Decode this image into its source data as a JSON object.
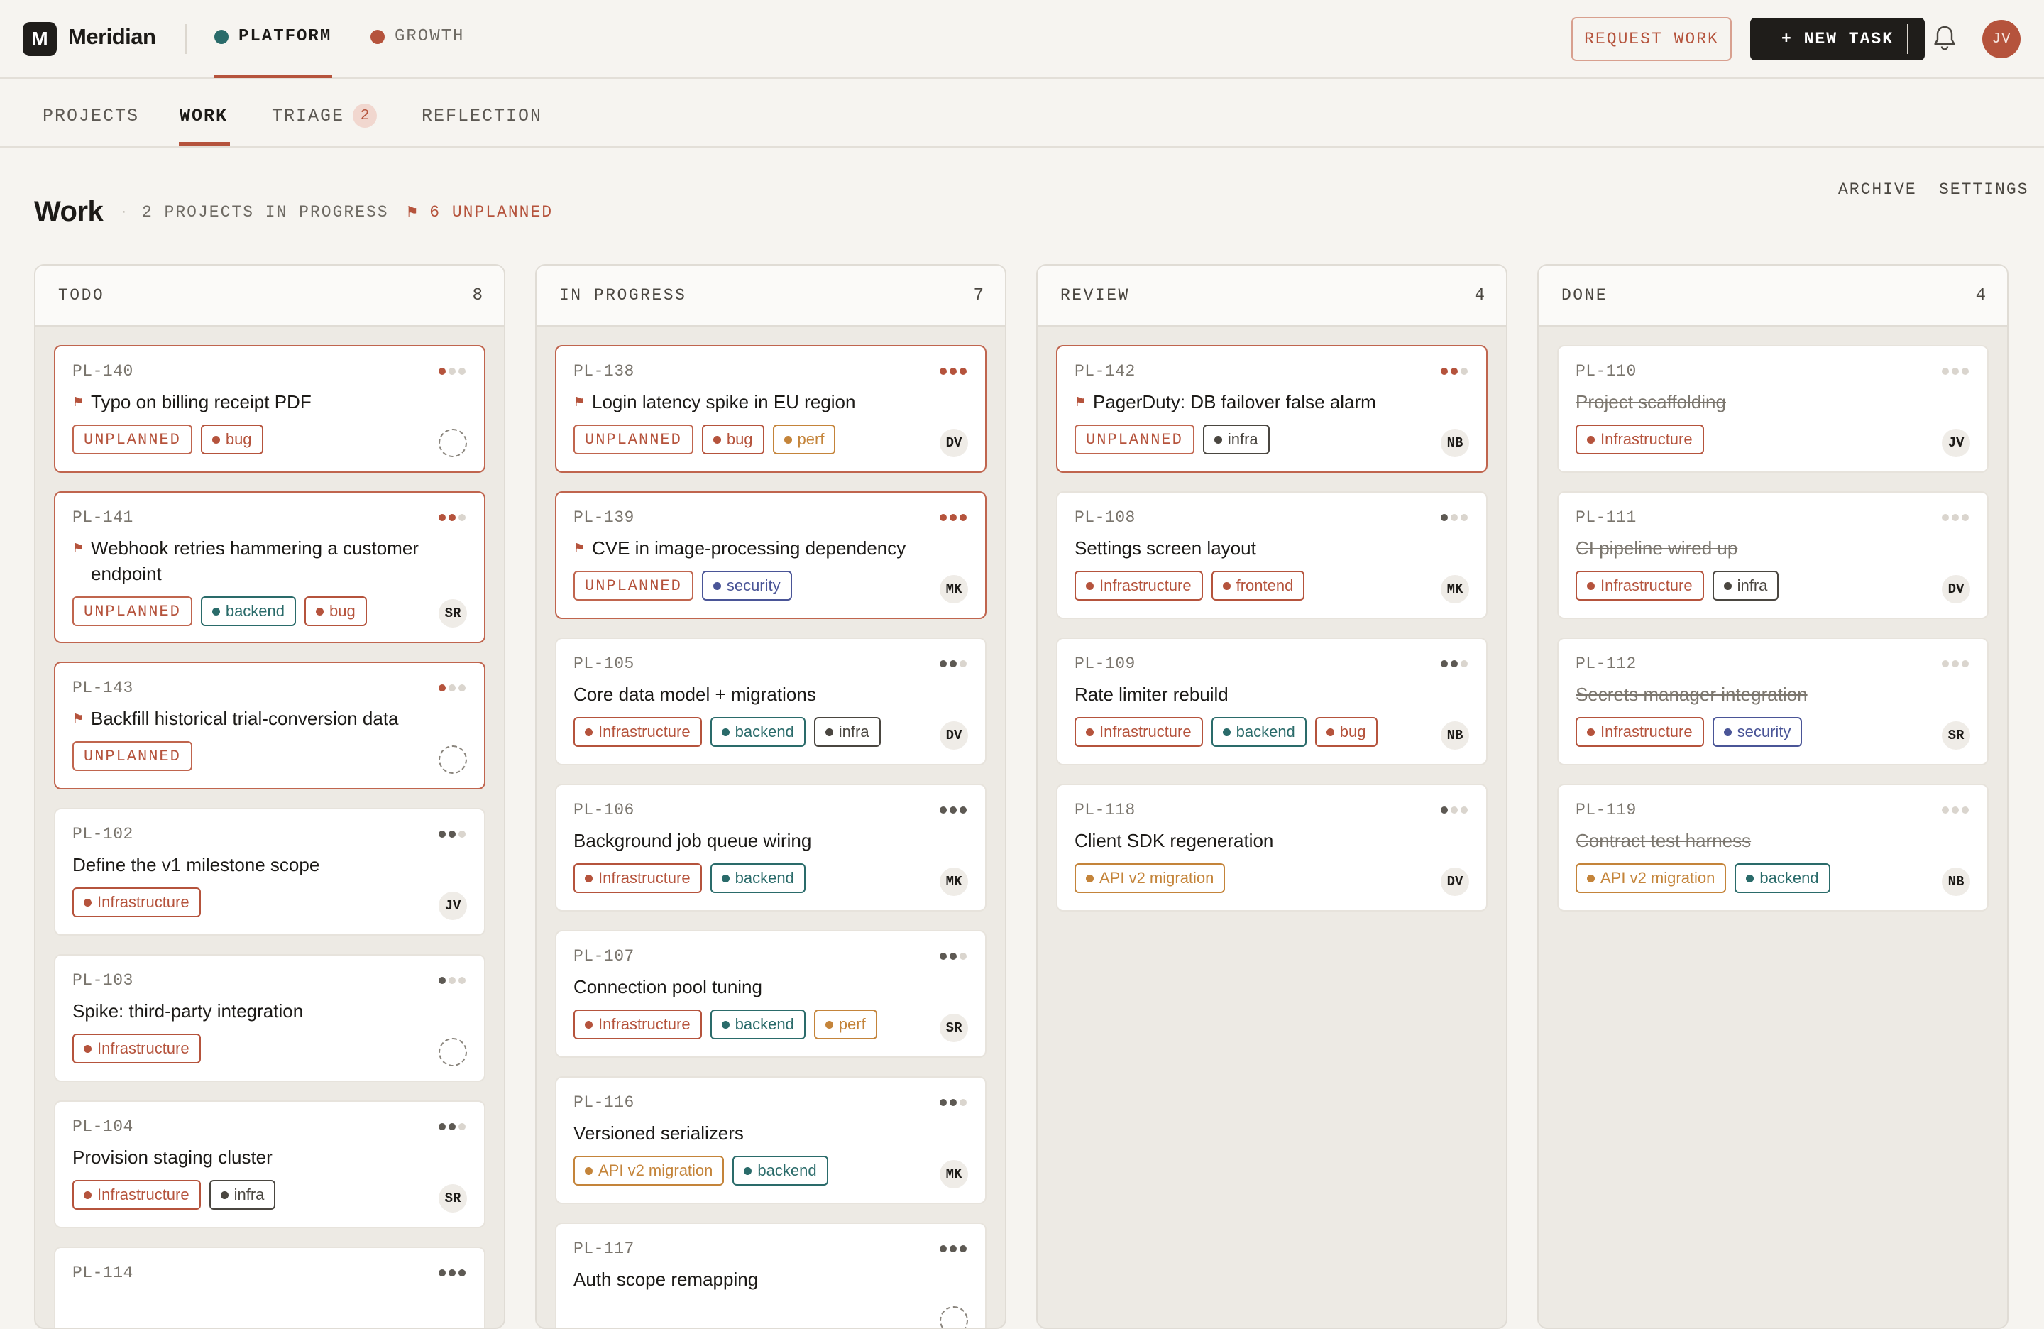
{
  "app": {
    "logo_letter": "M",
    "name": "Meridian"
  },
  "teams": [
    {
      "label": "PLATFORM",
      "color": "#2a6b6a",
      "active": true
    },
    {
      "label": "GROWTH",
      "color": "#b5533c",
      "active": false
    }
  ],
  "header": {
    "request_label": "REQUEST WORK",
    "new_task_label": "+ NEW TASK",
    "avatar": "JV",
    "bell_icon": "bell-icon"
  },
  "nav": {
    "tabs": [
      {
        "label": "PROJECTS"
      },
      {
        "label": "WORK"
      },
      {
        "label": "TRIAGE",
        "badge": "2"
      },
      {
        "label": "REFLECTION"
      }
    ],
    "archive": "ARCHIVE",
    "settings": "SETTINGS"
  },
  "page": {
    "title": "Work",
    "in_progress": "2 PROJECTS IN PROGRESS",
    "unplanned": "⚑ 6 UNPLANNED"
  },
  "colors": {
    "accent": "#b5533c",
    "teal": "#2a6b6a",
    "indigo": "#4a5597",
    "amber": "#c4843a",
    "gray": "#4a4640"
  },
  "tag_colors": {
    "Infrastructure": "#b5533c",
    "bug": "#b5533c",
    "backend": "#2a6b6a",
    "perf": "#c4843a",
    "infra": "#4a4640",
    "security": "#4a5597",
    "frontend": "#b5533c",
    "API v2 migration": "#c4843a"
  },
  "columns": [
    {
      "title": "TODO",
      "count": "8",
      "cards": [
        {
          "id": "PL-140",
          "title": "Typo on billing receipt PDF",
          "flag": true,
          "unplanned": true,
          "tags": [
            "bug"
          ],
          "assignee": "",
          "priority": 1
        },
        {
          "id": "PL-141",
          "title": "Webhook retries hammering a customer endpoint",
          "flag": true,
          "unplanned": true,
          "tags": [
            "backend",
            "bug"
          ],
          "assignee": "SR",
          "priority": 2
        },
        {
          "id": "PL-143",
          "title": "Backfill historical trial-conversion data",
          "flag": true,
          "unplanned": true,
          "tags": [],
          "assignee": "",
          "priority": 1
        },
        {
          "id": "PL-102",
          "title": "Define the v1 milestone scope",
          "tags": [
            "Infrastructure"
          ],
          "assignee": "JV",
          "priority": 2
        },
        {
          "id": "PL-103",
          "title": "Spike: third-party integration",
          "tags": [
            "Infrastructure"
          ],
          "assignee": "",
          "priority": 1
        },
        {
          "id": "PL-104",
          "title": "Provision staging cluster",
          "tags": [
            "Infrastructure",
            "infra"
          ],
          "assignee": "SR",
          "priority": 2
        },
        {
          "id": "PL-114",
          "title": "",
          "tags": [],
          "assignee": "",
          "priority": 3
        }
      ]
    },
    {
      "title": "IN PROGRESS",
      "count": "7",
      "cards": [
        {
          "id": "PL-138",
          "title": "Login latency spike in EU region",
          "flag": true,
          "unplanned": true,
          "tags": [
            "bug",
            "perf"
          ],
          "assignee": "DV",
          "priority": 3
        },
        {
          "id": "PL-139",
          "title": "CVE in image-processing dependency",
          "flag": true,
          "unplanned": true,
          "tags": [
            "security"
          ],
          "assignee": "MK",
          "priority": 3
        },
        {
          "id": "PL-105",
          "title": "Core data model + migrations",
          "tags": [
            "Infrastructure",
            "backend",
            "infra"
          ],
          "assignee": "DV",
          "priority": 2
        },
        {
          "id": "PL-106",
          "title": "Background job queue wiring",
          "tags": [
            "Infrastructure",
            "backend"
          ],
          "assignee": "MK",
          "priority": 3
        },
        {
          "id": "PL-107",
          "title": "Connection pool tuning",
          "tags": [
            "Infrastructure",
            "backend",
            "perf"
          ],
          "assignee": "SR",
          "priority": 2
        },
        {
          "id": "PL-116",
          "title": "Versioned serializers",
          "tags": [
            "API v2 migration",
            "backend"
          ],
          "assignee": "MK",
          "priority": 2
        },
        {
          "id": "PL-117",
          "title": "Auth scope remapping",
          "tags": [],
          "assignee": "",
          "priority": 3
        }
      ]
    },
    {
      "title": "REVIEW",
      "count": "4",
      "cards": [
        {
          "id": "PL-142",
          "title": "PagerDuty: DB failover false alarm",
          "flag": true,
          "unplanned": true,
          "tags": [
            "infra"
          ],
          "assignee": "NB",
          "priority": 2
        },
        {
          "id": "PL-108",
          "title": "Settings screen layout",
          "tags": [
            "Infrastructure",
            "frontend"
          ],
          "assignee": "MK",
          "priority": 1
        },
        {
          "id": "PL-109",
          "title": "Rate limiter rebuild",
          "tags": [
            "Infrastructure",
            "backend",
            "bug"
          ],
          "assignee": "NB",
          "priority": 2
        },
        {
          "id": "PL-118",
          "title": "Client SDK regeneration",
          "tags": [
            "API v2 migration"
          ],
          "assignee": "DV",
          "priority": 1
        }
      ]
    },
    {
      "title": "DONE",
      "count": "4",
      "done": true,
      "cards": [
        {
          "id": "PL-110",
          "title": "Project scaffolding",
          "tags": [
            "Infrastructure"
          ],
          "assignee": "JV",
          "priority": 0
        },
        {
          "id": "PL-111",
          "title": "CI pipeline wired up",
          "tags": [
            "Infrastructure",
            "infra"
          ],
          "assignee": "DV",
          "priority": 0
        },
        {
          "id": "PL-112",
          "title": "Secrets manager integration",
          "tags": [
            "Infrastructure",
            "security"
          ],
          "assignee": "SR",
          "priority": 0
        },
        {
          "id": "PL-119",
          "title": "Contract test harness",
          "tags": [
            "API v2 migration",
            "backend"
          ],
          "assignee": "NB",
          "priority": 0
        }
      ]
    }
  ]
}
